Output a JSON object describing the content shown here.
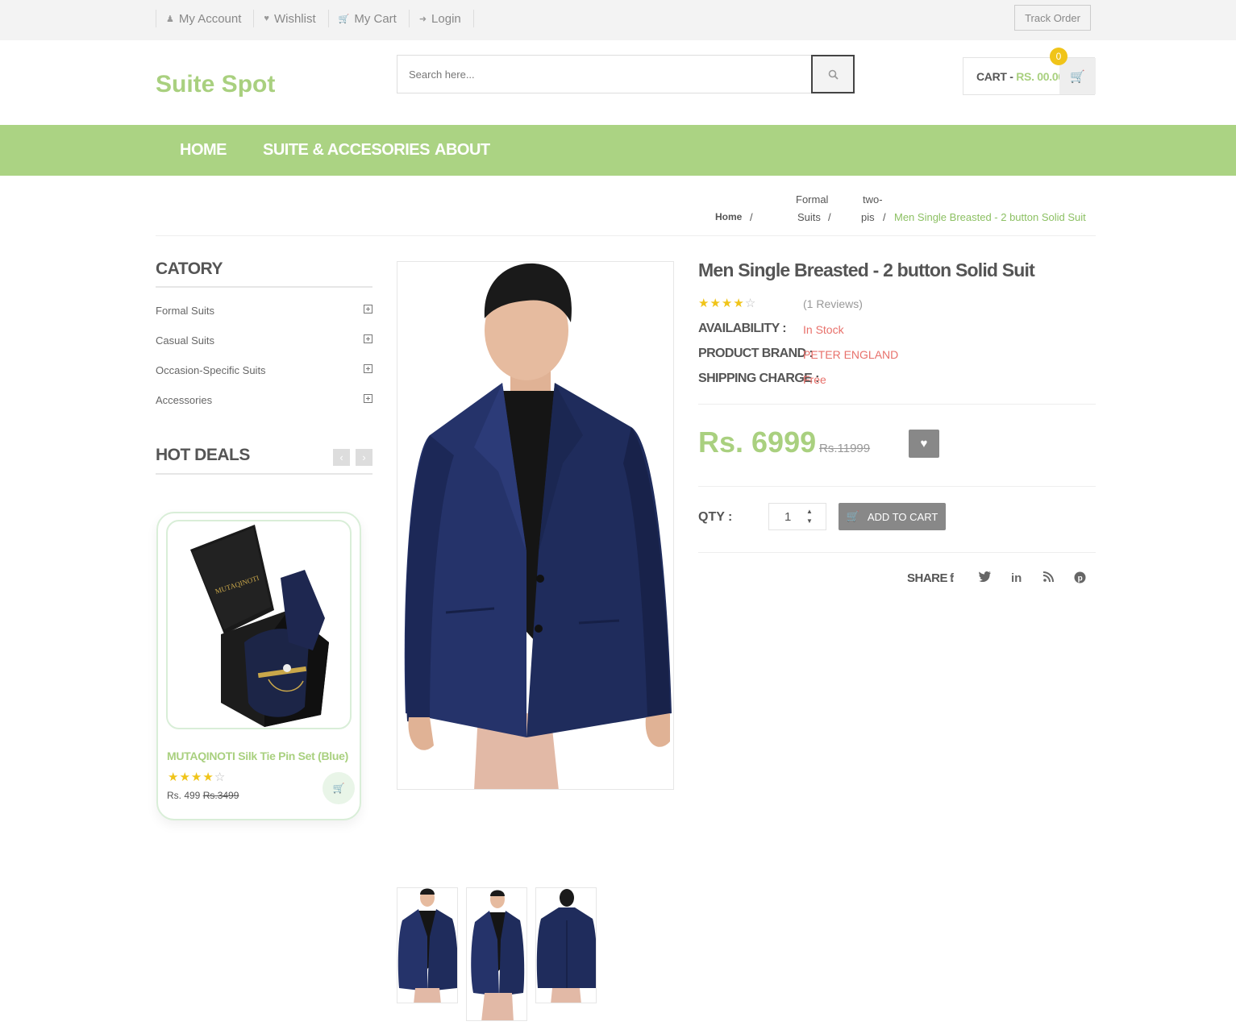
{
  "topbar": {
    "links": [
      {
        "icon": "user-icon",
        "label": "My Account"
      },
      {
        "icon": "heart-icon",
        "label": "Wishlist"
      },
      {
        "icon": "cart-icon",
        "label": "My Cart"
      },
      {
        "icon": "login-icon",
        "label": "Login"
      }
    ],
    "track_order": "Track Order"
  },
  "header": {
    "logo": "Suite Spot",
    "search_placeholder": "Search here...",
    "cart_label": "CART - ",
    "cart_amount": "RS. 00.00",
    "cart_count": "0"
  },
  "nav": {
    "items": [
      "HOME",
      "SUITE & ACCESORIES",
      "ABOUT"
    ]
  },
  "breadcrumb": {
    "home": "Home",
    "cat_line1": "Formal",
    "cat_line2": "Suits",
    "sub_line1": "two-",
    "sub_line2": "pis",
    "current": "Men Single Breasted - 2 button Solid Suit",
    "sep": "/"
  },
  "sidebar": {
    "category_title": "CATORY",
    "categories": [
      "Formal Suits",
      "Casual Suits",
      "Occasion-Specific Suits",
      "Accessories"
    ],
    "hot_deals_title": "HOT DEALS",
    "deal": {
      "brand_text": "MUTAQINOTI",
      "name": "MUTAQINOTI Silk Tie Pin Set (Blue)",
      "rating": 4,
      "rating_max": 5,
      "price": "Rs. 499",
      "old_price": "Rs.3499"
    }
  },
  "product": {
    "title": "Men Single Breasted - 2 button Solid Suit",
    "rating": 4,
    "rating_max": 5,
    "reviews": "(1 Reviews)",
    "availability_label": "AVAILABILITY :",
    "availability": "In Stock",
    "brand_label": "PRODUCT BRAND :",
    "brand": "PETER ENGLAND",
    "shipping_label": "SHIPPING CHARGE :",
    "shipping": "Free",
    "price": "Rs. 6999",
    "old_price": "Rs.11999",
    "qty_label": "QTY :",
    "qty": "1",
    "add_to_cart": "ADD TO CART",
    "share_label": "SHARE :"
  },
  "colors": {
    "accent": "#abd383",
    "sale_red": "#e8716b",
    "star": "#f0c419",
    "suit_navy": "#1f2c5c"
  }
}
